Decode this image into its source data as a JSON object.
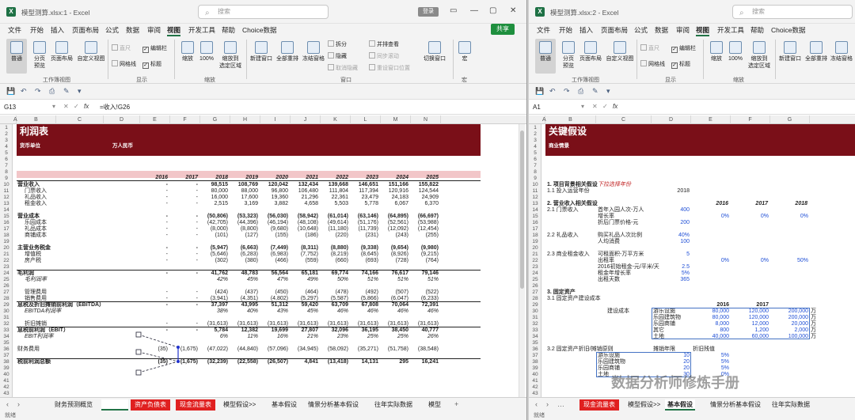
{
  "left": {
    "title": "模型测算.xlsx:1  -  Excel",
    "search_placeholder": "搜索",
    "badge": "登录",
    "share": "共享",
    "menus": [
      "文件",
      "开始",
      "插入",
      "页面布局",
      "公式",
      "数据",
      "审阅",
      "视图",
      "开发工具",
      "帮助",
      "Choice数据"
    ],
    "active_menu": "视图",
    "ribbon": {
      "normal": "普通",
      "pagebreak": "分页\n预览",
      "pagelayout": "页面布局",
      "custom": "自定义视图",
      "ruler": "直尺",
      "formula_bar": "编辑栏",
      "gridlines": "网格线",
      "headings": "标题",
      "zoom": "缩放",
      "zoom100": "100%",
      "zoomsel": "缩放到\n选定区域",
      "newwin": "新建窗口",
      "arrange": "全部重排",
      "freeze": "冻结窗格",
      "split": "拆分",
      "hide": "隐藏",
      "unhide": "取消隐藏",
      "side": "并排查看",
      "sync": "同步滚动",
      "reset": "重设窗口位置",
      "switch": "切换窗口",
      "macro": "宏",
      "g_views": "工作簿视图",
      "g_show": "显示",
      "g_zoom": "缩放",
      "g_window": "窗口",
      "g_macro": "宏"
    },
    "namebox": "G13",
    "formula": "=收入!G26",
    "columns": [
      "A",
      "B",
      "C",
      "D",
      "E",
      "F",
      "G",
      "H",
      "I",
      "J",
      "K",
      "L",
      "M",
      "N"
    ],
    "sheet_title": "利润表",
    "currency_label": "货币单位",
    "currency_value": "万人民币",
    "years": [
      "2016",
      "2017",
      "2018",
      "2019",
      "2020",
      "2021",
      "2022",
      "2023",
      "2024",
      "2025"
    ],
    "rows": [
      {
        "r": "10",
        "label": "营业收入",
        "b": true,
        "v": [
          "-",
          "-",
          "98,515",
          "108,769",
          "120,042",
          "132,434",
          "139,668",
          "146,651",
          "151,166",
          "155,822"
        ]
      },
      {
        "r": "11",
        "label": "门票收入",
        "ind": true,
        "v": [
          "-",
          "-",
          "80,000",
          "88,000",
          "96,800",
          "106,480",
          "111,804",
          "117,394",
          "120,916",
          "124,544"
        ]
      },
      {
        "r": "12",
        "label": "礼品收入",
        "ind": true,
        "v": [
          "-",
          "-",
          "16,000",
          "17,600",
          "19,360",
          "21,296",
          "22,361",
          "23,479",
          "24,183",
          "24,909"
        ]
      },
      {
        "r": "13",
        "label": "租金收入",
        "ind": true,
        "v": [
          "-",
          "-",
          "2,515",
          "3,169",
          "3,882",
          "4,658",
          "5,503",
          "5,778",
          "6,067",
          "6,370"
        ]
      },
      {
        "r": "14",
        "label": "",
        "v": []
      },
      {
        "r": "15",
        "label": "营业成本",
        "b": true,
        "v": [
          "-",
          "-",
          "(50,806)",
          "(53,323)",
          "(56,030)",
          "(58,942)",
          "(61,014)",
          "(63,146)",
          "(64,895)",
          "(66,697)"
        ]
      },
      {
        "r": "16",
        "label": "乐园成本",
        "ind": true,
        "v": [
          "-",
          "-",
          "(42,705)",
          "(44,396)",
          "(46,194)",
          "(48,108)",
          "(49,614)",
          "(51,176)",
          "(52,561)",
          "(53,988)"
        ]
      },
      {
        "r": "17",
        "label": "礼品成本",
        "ind": true,
        "v": [
          "-",
          "-",
          "(8,000)",
          "(8,800)",
          "(9,680)",
          "(10,648)",
          "(11,180)",
          "(11,739)",
          "(12,092)",
          "(12,454)"
        ]
      },
      {
        "r": "18",
        "label": "商铺成本",
        "ind": true,
        "v": [
          "-",
          "-",
          "(101)",
          "(127)",
          "(155)",
          "(186)",
          "(220)",
          "(231)",
          "(243)",
          "(255)"
        ]
      },
      {
        "r": "19",
        "label": "",
        "v": []
      },
      {
        "r": "20",
        "label": "主营业务税金",
        "b": true,
        "v": [
          "-",
          "-",
          "(5,947)",
          "(6,663)",
          "(7,449)",
          "(8,311)",
          "(8,880)",
          "(9,338)",
          "(9,654)",
          "(9,980)"
        ]
      },
      {
        "r": "21",
        "label": "增值税",
        "ind": true,
        "v": [
          "-",
          "-",
          "(5,646)",
          "(6,283)",
          "(6,983)",
          "(7,752)",
          "(8,219)",
          "(8,645)",
          "(8,926)",
          "(9,215)"
        ]
      },
      {
        "r": "22",
        "label": "房产税",
        "ind": true,
        "v": [
          "-",
          "-",
          "(302)",
          "(380)",
          "(466)",
          "(559)",
          "(660)",
          "(693)",
          "(728)",
          "(764)"
        ]
      },
      {
        "r": "23",
        "label": "",
        "v": []
      },
      {
        "r": "24",
        "label": "毛利润",
        "b": true,
        "line": true,
        "v": [
          "-",
          "-",
          "41,762",
          "48,783",
          "56,564",
          "65,181",
          "69,774",
          "74,166",
          "76,617",
          "79,146"
        ]
      },
      {
        "r": "25",
        "label": "毛利润率",
        "ind": true,
        "it": true,
        "v": [
          "",
          "",
          "42%",
          "45%",
          "47%",
          "49%",
          "50%",
          "51%",
          "51%",
          "51%"
        ]
      },
      {
        "r": "26",
        "label": "",
        "v": []
      },
      {
        "r": "27",
        "label": "管理费用",
        "ind": true,
        "v": [
          "-",
          "-",
          "(424)",
          "(437)",
          "(450)",
          "(464)",
          "(478)",
          "(492)",
          "(507)",
          "(522)"
        ]
      },
      {
        "r": "28",
        "label": "销售费用",
        "ind": true,
        "v": [
          "-",
          "-",
          "(3,941)",
          "(4,351)",
          "(4,802)",
          "(5,297)",
          "(5,587)",
          "(5,866)",
          "(6,047)",
          "(6,233)"
        ]
      },
      {
        "r": "29",
        "label": "息税及折旧摊销前利润（EBITDA）",
        "b": true,
        "line": true,
        "v": [
          "-",
          "-",
          "37,397",
          "43,995",
          "51,312",
          "59,420",
          "63,709",
          "67,808",
          "70,064",
          "72,391"
        ]
      },
      {
        "r": "30",
        "label": "EBITDA利润率",
        "ind": true,
        "it": true,
        "v": [
          "",
          "",
          "38%",
          "40%",
          "43%",
          "45%",
          "46%",
          "46%",
          "46%",
          "46%"
        ]
      },
      {
        "r": "31",
        "label": "",
        "v": []
      },
      {
        "r": "32",
        "label": "折旧摊销",
        "ind": true,
        "v": [
          "-",
          "-",
          "(31,613)",
          "(31,613)",
          "(31,613)",
          "(31,613)",
          "(31,613)",
          "(31,613)",
          "(31,613)",
          "(31,613)"
        ]
      },
      {
        "r": "33",
        "label": "息税前利润（EBIT）",
        "b": true,
        "line": true,
        "v": [
          "-",
          "-",
          "5,784",
          "12,382",
          "19,699",
          "27,807",
          "32,096",
          "36,195",
          "38,450",
          "40,777"
        ]
      },
      {
        "r": "34",
        "label": "EBIT利润率",
        "ind": true,
        "it": true,
        "v": [
          "",
          "",
          "6%",
          "11%",
          "16%",
          "21%",
          "23%",
          "25%",
          "25%",
          "26%"
        ]
      },
      {
        "r": "35",
        "label": "",
        "v": []
      },
      {
        "r": "36",
        "label": "财务费用",
        "v": [
          "(35)",
          "(1,675)",
          "(47,022)",
          "(44,840)",
          "(57,096)",
          "(34,945)",
          "(58,092)",
          "(35,271)",
          "(51,758)",
          "(38,548)"
        ]
      },
      {
        "r": "37",
        "label": "",
        "v": []
      },
      {
        "r": "38",
        "label": "税前利润总额",
        "b": true,
        "line": true,
        "v": [
          "(35)",
          "(1,675)",
          "(32,239)",
          "(22,558)",
          "(26,507)",
          "4,841",
          "(13,418)",
          "14,131",
          "295",
          "16,241"
        ]
      },
      {
        "r": "39",
        "label": "",
        "v": []
      }
    ],
    "tabs": [
      "财务预测概览",
      "利润表",
      "资产负债表",
      "现金流量表",
      "模型假设>>",
      "基本假设",
      "情景分析基本假设",
      "往年实际数据",
      "模型"
    ],
    "status": "就绪"
  },
  "right": {
    "title": "模型测算.xlsx:2  -  Excel",
    "search_placeholder": "搜索",
    "menus": [
      "文件",
      "开始",
      "插入",
      "页面布局",
      "公式",
      "数据",
      "审阅",
      "视图",
      "开发工具",
      "帮助",
      "Choice数据"
    ],
    "active_menu": "视图",
    "ribbon": {
      "normal": "普通",
      "pagebreak": "分页\n预览",
      "pagelayout": "页面布局",
      "custom": "自定义视图",
      "ruler": "直尺",
      "formula_bar": "编辑栏",
      "gridlines": "网格线",
      "headings": "标题",
      "zoom": "缩放",
      "zoom100": "100%",
      "zoomsel": "缩放到\n选定区域",
      "newwin": "新建窗口",
      "arrange": "全部重排",
      "freeze": "冻结窗格",
      "g_views": "工作簿视图",
      "g_show": "显示",
      "g_zoom": "缩放"
    },
    "namebox": "A1",
    "columns": [
      "A",
      "B",
      "C",
      "D",
      "E",
      "F",
      "G"
    ],
    "sheet_title": "关键假设",
    "subtitle": "商业情景",
    "years": [
      "2016",
      "2017",
      "2018"
    ],
    "tabs": [
      "现金流量表",
      "模型假设>>",
      "基本假设",
      "情景分析基本假设",
      "往年实际数据"
    ],
    "status": "就绪",
    "cells": {
      "r10a": "1. 项目背景相关假设",
      "r10c": "下拉选择年份",
      "r11a": "1.1 投入运营年份",
      "r11d": "2018",
      "r13a": "2. 营业收入相关假设",
      "r14a": "2.1 门票收入",
      "r14c": "首年入园人次-万人",
      "r14d": "400",
      "r15c": "增长率",
      "r15e": "0%",
      "r15f": "0%",
      "r15g": "0%",
      "r16c": "折后门票价格-元",
      "r16d": "200",
      "r18a": "2.2 礼品收入",
      "r18c": "购买礼品人次比例",
      "r18d": "40%",
      "r19c": "人均消费",
      "r19d": "100",
      "r21a": "2.3 商业租金收入",
      "r21c": "可租面积-万平方米",
      "r21d": "5",
      "r22c": "出租率",
      "r22e": "0%",
      "r22f": "0%",
      "r22g": "50%",
      "r23c": "2016初始租金-元/平米/天",
      "r23d": "2.5",
      "r24c": "租金年增长率",
      "r24d": "5%",
      "r25c": "出租天数",
      "r25d": "365",
      "r27a": "3. 固定资产",
      "r28a": "3.1 固定资产建设成本",
      "r29e": "2016",
      "r29f": "2017",
      "r30c": "建设成本",
      "r30d": "游乐设施",
      "r30e": "80,000",
      "r30f": "120,000",
      "r30g": "200,000",
      "r31d": "乐园建筑物",
      "r31e": "80,000",
      "r31f": "120,000",
      "r31g": "200,000",
      "r32d": "乐园商铺",
      "r32e": "8,000",
      "r32f": "12,000",
      "r32g": "20,000",
      "r33d": "其它",
      "r33e": "800",
      "r33f": "1,200",
      "r33g": "2,000",
      "r34d": "土地",
      "r34e": "40,000",
      "r34f": "60,000",
      "r34g": "100,000",
      "r36a": "3.2 固定资产折旧/摊销原则",
      "r36d": "摊销年限",
      "r36e": "折旧残值",
      "r37c": "游乐设施",
      "r37d": "10",
      "r37e": "5%",
      "r38c": "乐园建筑物",
      "r38d": "20",
      "r38e": "5%",
      "r39c": "乐园商铺",
      "r39d": "20",
      "r39e": "5%",
      "r40c": "土地",
      "r40d": "30",
      "r40e": "0%"
    },
    "unit_suffix": "万"
  },
  "watermark": "数据分析师修炼手册",
  "colors": {
    "header_band": "#7a0f18",
    "pink_band": "#f2c6c8",
    "accent": "#217346",
    "red_tab": "#e02020",
    "blue_input": "#1f4fd6"
  }
}
